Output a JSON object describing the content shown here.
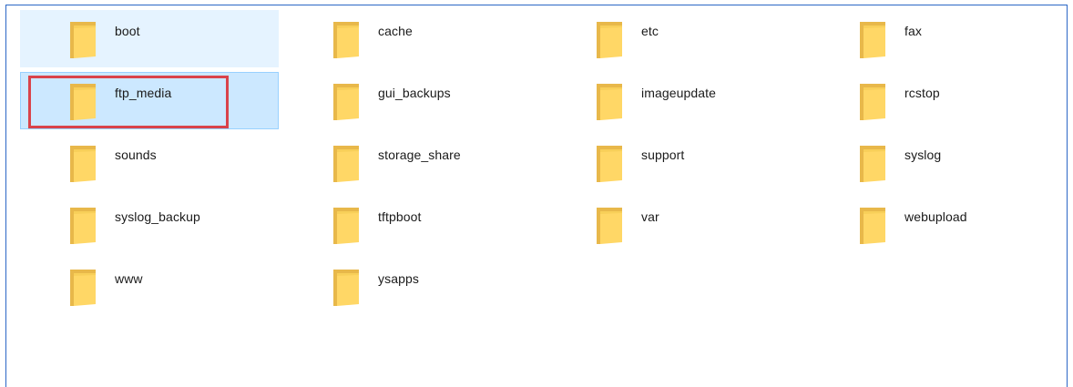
{
  "colors": {
    "pane_border": "#2b67c6",
    "selected_bg": "#cce8ff",
    "hover_bg": "#e5f3ff",
    "annotation": "#d9434a",
    "folder_back": "#e8b84a",
    "folder_front": "#ffd766"
  },
  "folders": [
    {
      "name": "boot",
      "icon": "folder-icon",
      "state": "hover"
    },
    {
      "name": "cache",
      "icon": "folder-icon",
      "state": "normal"
    },
    {
      "name": "etc",
      "icon": "folder-icon",
      "state": "normal"
    },
    {
      "name": "fax",
      "icon": "folder-icon",
      "state": "normal"
    },
    {
      "name": "ftp_media",
      "icon": "folder-icon",
      "state": "selected",
      "annotated": true
    },
    {
      "name": "gui_backups",
      "icon": "folder-icon",
      "state": "normal"
    },
    {
      "name": "imageupdate",
      "icon": "folder-icon",
      "state": "normal"
    },
    {
      "name": "rcstop",
      "icon": "folder-icon",
      "state": "normal"
    },
    {
      "name": "sounds",
      "icon": "folder-icon",
      "state": "normal"
    },
    {
      "name": "storage_share",
      "icon": "folder-icon",
      "state": "normal"
    },
    {
      "name": "support",
      "icon": "folder-icon",
      "state": "normal"
    },
    {
      "name": "syslog",
      "icon": "folder-icon",
      "state": "normal"
    },
    {
      "name": "syslog_backup",
      "icon": "folder-icon",
      "state": "normal"
    },
    {
      "name": "tftpboot",
      "icon": "folder-icon",
      "state": "normal"
    },
    {
      "name": "var",
      "icon": "folder-icon",
      "state": "normal"
    },
    {
      "name": "webupload",
      "icon": "folder-icon",
      "state": "normal"
    },
    {
      "name": "www",
      "icon": "folder-icon",
      "state": "normal"
    },
    {
      "name": "ysapps",
      "icon": "folder-icon",
      "state": "normal"
    }
  ]
}
